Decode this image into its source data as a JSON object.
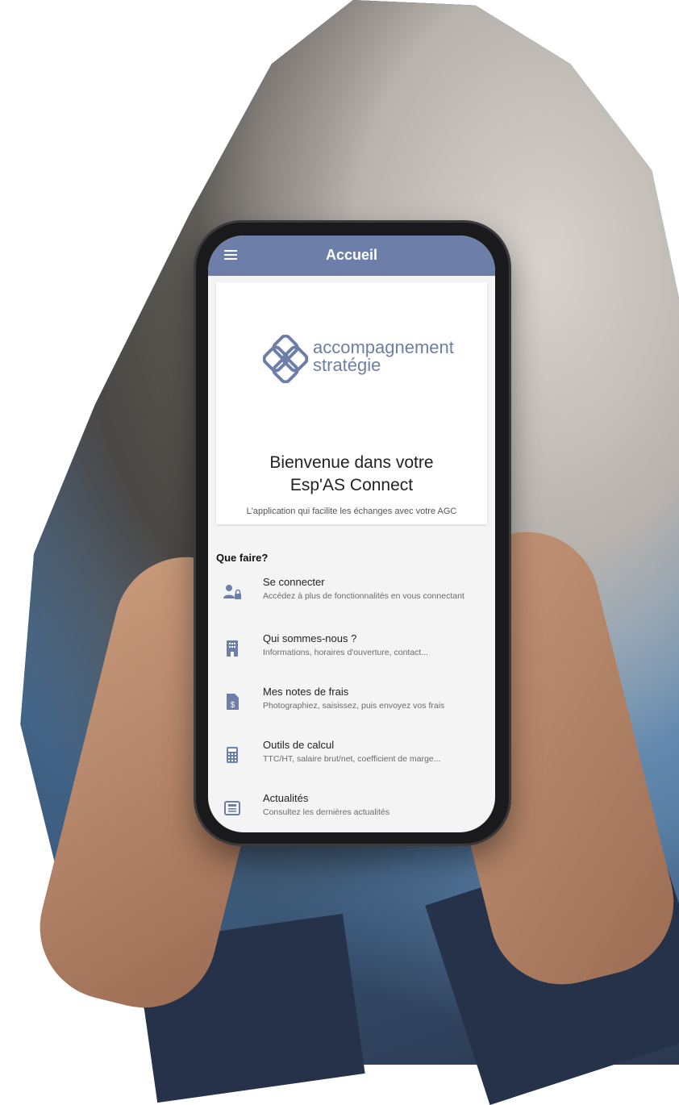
{
  "header": {
    "title": "Accueil"
  },
  "brand": {
    "line1": "accompagnement",
    "line2": "stratégie",
    "color": "#6d7fa8"
  },
  "welcome": {
    "line1": "Bienvenue dans votre",
    "line2": "Esp'AS Connect",
    "tagline": "L'application qui facilite les échanges avec votre AGC"
  },
  "section": {
    "title": "Que faire?"
  },
  "items": [
    {
      "icon": "user-lock-icon",
      "title": "Se connecter",
      "desc": "Accédez à plus de fonctionnalités en vous connectant"
    },
    {
      "icon": "building-icon",
      "title": "Qui sommes-nous ?",
      "desc": "Informations, horaires d'ouverture, contact..."
    },
    {
      "icon": "receipt-icon",
      "title": "Mes notes de frais",
      "desc": "Photographiez, saisissez, puis envoyez vos frais"
    },
    {
      "icon": "calculator-icon",
      "title": "Outils de calcul",
      "desc": "TTC/HT, salaire brut/net, coefficient de marge..."
    },
    {
      "icon": "news-icon",
      "title": "Actualités",
      "desc": "Consultez les dernières actualités"
    }
  ]
}
